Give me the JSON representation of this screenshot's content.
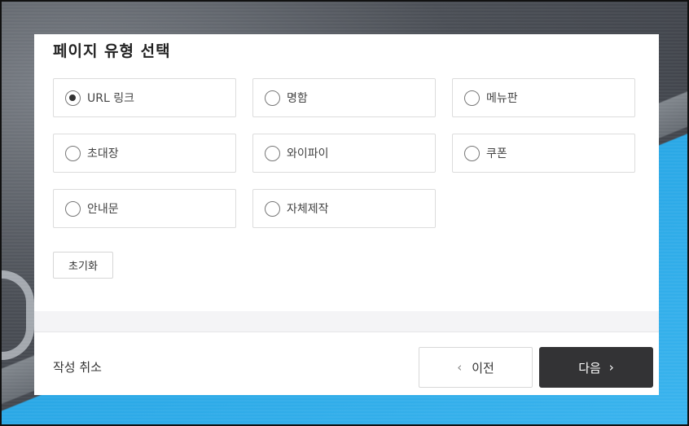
{
  "modal": {
    "title": "페이지 유형 선택",
    "options": [
      {
        "label": "URL 링크",
        "checked": true
      },
      {
        "label": "명함",
        "checked": false
      },
      {
        "label": "메뉴판",
        "checked": false
      },
      {
        "label": "초대장",
        "checked": false
      },
      {
        "label": "와이파이",
        "checked": false
      },
      {
        "label": "쿠폰",
        "checked": false
      },
      {
        "label": "안내문",
        "checked": false
      },
      {
        "label": "자체제작",
        "checked": false
      }
    ],
    "reset_label": "초기화"
  },
  "footer": {
    "cancel_label": "작성 취소",
    "prev_label": "이전",
    "next_label": "다음",
    "prev_icon": "chevron-left-icon",
    "next_icon": "chevron-right-icon"
  },
  "colors": {
    "next_button": "#333335",
    "accent_background": "#2aa8e6"
  }
}
